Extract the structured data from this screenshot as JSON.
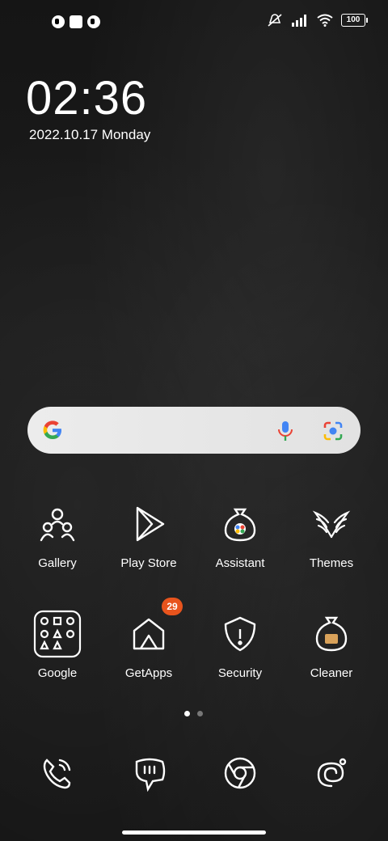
{
  "status_bar": {
    "left_icons": [
      "notification-icon-1",
      "stop-icon",
      "notification-icon-2"
    ],
    "right_icons": [
      "mute-icon",
      "signal-icon",
      "wifi-icon",
      "battery-icon"
    ],
    "battery_level": "100"
  },
  "clock": {
    "time": "02:36",
    "date": "2022.10.17 Monday"
  },
  "search": {
    "icons": [
      "google-logo-icon",
      "mic-icon",
      "lens-icon"
    ]
  },
  "apps": [
    {
      "label": "Gallery",
      "icon": "gallery-icon"
    },
    {
      "label": "Play Store",
      "icon": "play-store-icon"
    },
    {
      "label": "Assistant",
      "icon": "assistant-icon"
    },
    {
      "label": "Themes",
      "icon": "themes-icon"
    },
    {
      "label": "Google",
      "icon": "google-folder-icon"
    },
    {
      "label": "GetApps",
      "icon": "getapps-icon",
      "badge": "29"
    },
    {
      "label": "Security",
      "icon": "security-icon"
    },
    {
      "label": "Cleaner",
      "icon": "cleaner-icon"
    }
  ],
  "page_indicator": {
    "pages": 2,
    "active": 1
  },
  "dock": [
    {
      "icon": "phone-icon"
    },
    {
      "icon": "messages-icon"
    },
    {
      "icon": "chrome-icon"
    },
    {
      "icon": "camera-icon"
    }
  ],
  "colors": {
    "badge": "#e8541d",
    "search_bar": "#ececec"
  }
}
